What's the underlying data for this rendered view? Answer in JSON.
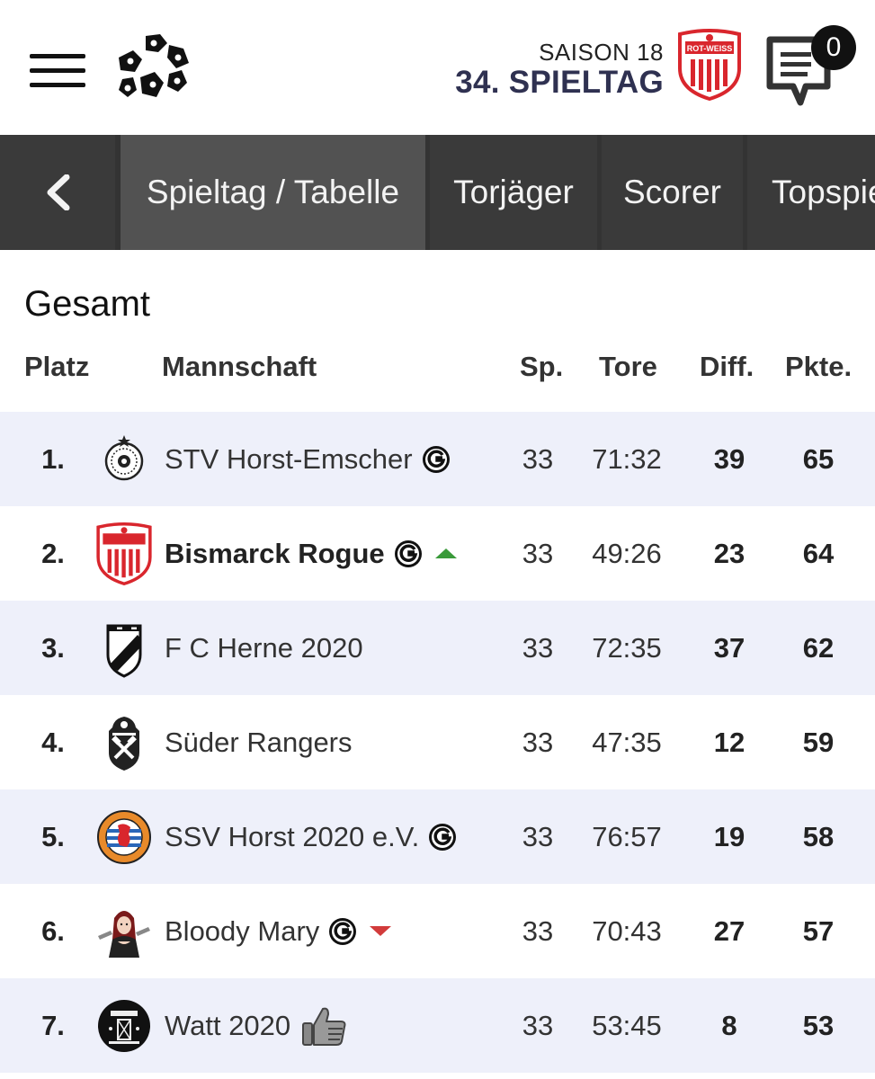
{
  "header": {
    "season_label": "SAISON 18",
    "matchday_label": "34. SPIELTAG",
    "message_count": "0",
    "crest_text_top": "ROT-WEISS"
  },
  "nav": {
    "tabs": [
      {
        "label": "Spieltag / Tabelle",
        "active": true
      },
      {
        "label": "Torjäger",
        "active": false
      },
      {
        "label": "Scorer",
        "active": false
      },
      {
        "label": "Topspie",
        "active": false
      }
    ]
  },
  "section": {
    "title": "Gesamt"
  },
  "table": {
    "columns": {
      "rank": "Platz",
      "team": "Mannschaft",
      "games": "Sp.",
      "goals": "Tore",
      "diff": "Diff.",
      "points": "Pkte."
    },
    "rows": [
      {
        "rank": "1.",
        "team": "STV Horst-Emscher",
        "games": "33",
        "goals": "71:32",
        "diff": "39",
        "points": "65",
        "crest": "ball-crest-icon",
        "g_badge": true,
        "trend": "",
        "thumb": false,
        "own": false
      },
      {
        "rank": "2.",
        "team": "Bismarck Rogue",
        "games": "33",
        "goals": "49:26",
        "diff": "23",
        "points": "64",
        "crest": "rot-weiss-crest-icon",
        "g_badge": true,
        "trend": "up",
        "thumb": false,
        "own": true
      },
      {
        "rank": "3.",
        "team": "F C Herne 2020",
        "games": "33",
        "goals": "72:35",
        "diff": "37",
        "points": "62",
        "crest": "shield-stripe-crest-icon",
        "g_badge": false,
        "trend": "",
        "thumb": false,
        "own": false
      },
      {
        "rank": "4.",
        "team": "Süder Rangers",
        "games": "33",
        "goals": "47:35",
        "diff": "12",
        "points": "59",
        "crest": "hammer-crest-icon",
        "g_badge": false,
        "trend": "",
        "thumb": false,
        "own": false
      },
      {
        "rank": "5.",
        "team": "SSV Horst 2020 e.V.",
        "games": "33",
        "goals": "76:57",
        "diff": "19",
        "points": "58",
        "crest": "lion-crest-icon",
        "g_badge": true,
        "trend": "",
        "thumb": false,
        "own": false
      },
      {
        "rank": "6.",
        "team": "Bloody Mary",
        "games": "33",
        "goals": "70:43",
        "diff": "27",
        "points": "57",
        "crest": "character-crest-icon",
        "g_badge": true,
        "trend": "down",
        "thumb": false,
        "own": false
      },
      {
        "rank": "7.",
        "team": "Watt 2020",
        "games": "33",
        "goals": "53:45",
        "diff": "8",
        "points": "53",
        "crest": "watt-crest-icon",
        "g_badge": false,
        "trend": "",
        "thumb": true,
        "own": false
      }
    ]
  },
  "colors": {
    "tab_bar": "#333333",
    "tab_active": "#525252",
    "row_shaded": "#eef0fa",
    "matchday_text": "#2f3151",
    "trend_up": "#3a9a3a",
    "trend_down": "#d23b3b",
    "crest_red": "#d9262d"
  }
}
